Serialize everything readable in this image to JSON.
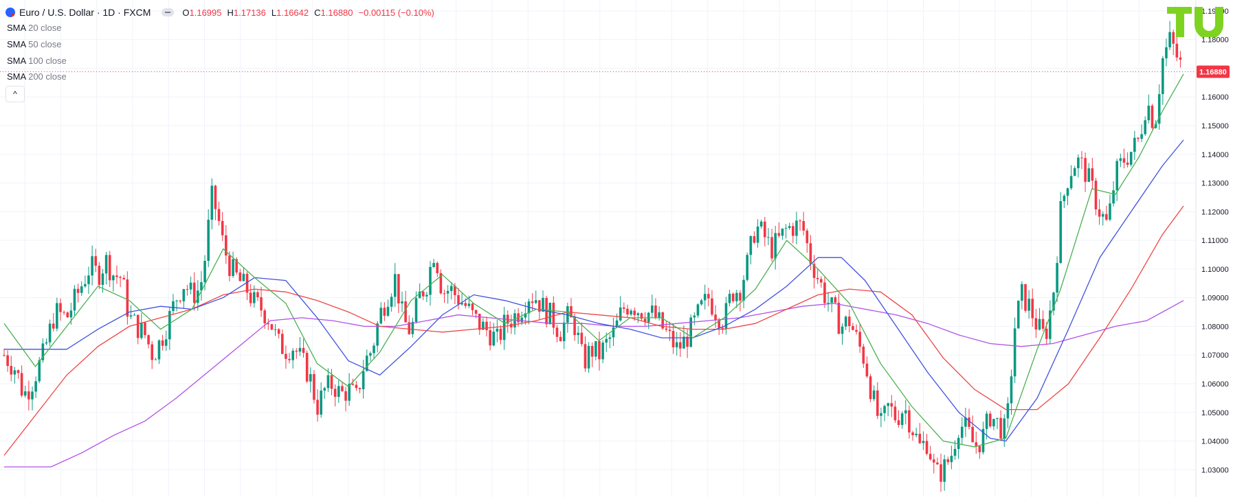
{
  "header": {
    "symbol_title": "Euro / U.S. Dollar · 1D · FXCM",
    "open_key": "O",
    "open_val": "1.16995",
    "high_key": "H",
    "high_val": "1.17136",
    "low_key": "L",
    "low_val": "1.16642",
    "close_key": "C",
    "close_val": "1.16880",
    "change": "−0.00115 (−0.10%)"
  },
  "indicators": [
    {
      "name": "SMA",
      "param": "20 close",
      "color": "#4caf50"
    },
    {
      "name": "SMA",
      "param": "50 close",
      "color": "#3f51e0"
    },
    {
      "name": "SMA",
      "param": "100 close",
      "color": "#ef4444"
    },
    {
      "name": "SMA",
      "param": "200 close",
      "color": "#b04fe8"
    }
  ],
  "collapse_label": "^",
  "colors": {
    "up": "#089981",
    "down": "#f23645",
    "grid": "#f0f3fa",
    "axis_text": "#131722",
    "price_tag": "#f23645"
  },
  "chart_data": {
    "type": "candlestick",
    "instrument": "EURUSD",
    "timeframe": "1D",
    "ylim": [
      1.0205,
      1.1938
    ],
    "y_ticks": [
      "1.19000",
      "1.18000",
      "1.17000",
      "1.16000",
      "1.15000",
      "1.14000",
      "1.13000",
      "1.12000",
      "1.11000",
      "1.10000",
      "1.09000",
      "1.08000",
      "1.07000",
      "1.06000",
      "1.05000",
      "1.04000",
      "1.03000"
    ],
    "last_price": "1.16880",
    "price_path": [
      [
        0,
        1.07
      ],
      [
        15,
        1.065
      ],
      [
        25,
        1.056
      ],
      [
        35,
        1.06
      ],
      [
        50,
        1.07
      ],
      [
        65,
        1.085
      ],
      [
        80,
        1.083
      ],
      [
        95,
        1.092
      ],
      [
        110,
        1.101
      ],
      [
        120,
        1.098
      ],
      [
        130,
        1.103
      ],
      [
        140,
        1.098
      ],
      [
        150,
        1.097
      ],
      [
        160,
        1.083
      ],
      [
        170,
        1.08
      ],
      [
        180,
        1.077
      ],
      [
        190,
        1.07
      ],
      [
        200,
        1.075
      ],
      [
        210,
        1.082
      ],
      [
        220,
        1.09
      ],
      [
        230,
        1.095
      ],
      [
        240,
        1.091
      ],
      [
        250,
        1.093
      ],
      [
        255,
        1.1
      ],
      [
        260,
        1.112
      ],
      [
        265,
        1.125
      ],
      [
        272,
        1.12
      ],
      [
        280,
        1.108
      ],
      [
        290,
        1.1
      ],
      [
        300,
        1.096
      ],
      [
        310,
        1.093
      ],
      [
        320,
        1.088
      ],
      [
        330,
        1.086
      ],
      [
        340,
        1.082
      ],
      [
        350,
        1.074
      ],
      [
        360,
        1.072
      ],
      [
        370,
        1.073
      ],
      [
        380,
        1.068
      ],
      [
        390,
        1.063
      ],
      [
        400,
        1.052
      ],
      [
        410,
        1.058
      ],
      [
        420,
        1.06
      ],
      [
        430,
        1.056
      ],
      [
        440,
        1.058
      ],
      [
        450,
        1.055
      ],
      [
        460,
        1.067
      ],
      [
        470,
        1.072
      ],
      [
        480,
        1.084
      ],
      [
        490,
        1.091
      ],
      [
        500,
        1.097
      ],
      [
        510,
        1.082
      ],
      [
        520,
        1.078
      ],
      [
        530,
        1.09
      ],
      [
        540,
        1.095
      ],
      [
        550,
        1.107
      ],
      [
        560,
        1.092
      ],
      [
        570,
        1.093
      ],
      [
        580,
        1.09
      ],
      [
        590,
        1.087
      ],
      [
        600,
        1.083
      ],
      [
        610,
        1.08
      ],
      [
        620,
        1.078
      ],
      [
        630,
        1.075
      ],
      [
        640,
        1.081
      ],
      [
        650,
        1.083
      ],
      [
        660,
        1.086
      ],
      [
        670,
        1.091
      ],
      [
        680,
        1.09
      ],
      [
        690,
        1.086
      ],
      [
        700,
        1.083
      ],
      [
        710,
        1.078
      ],
      [
        720,
        1.083
      ],
      [
        730,
        1.08
      ],
      [
        740,
        1.067
      ],
      [
        750,
        1.072
      ],
      [
        760,
        1.07
      ],
      [
        770,
        1.074
      ],
      [
        780,
        1.078
      ],
      [
        790,
        1.086
      ],
      [
        800,
        1.088
      ],
      [
        810,
        1.086
      ],
      [
        820,
        1.085
      ],
      [
        830,
        1.084
      ],
      [
        840,
        1.08
      ],
      [
        850,
        1.076
      ],
      [
        860,
        1.072
      ],
      [
        870,
        1.075
      ],
      [
        880,
        1.08
      ],
      [
        890,
        1.086
      ],
      [
        900,
        1.09
      ],
      [
        910,
        1.085
      ],
      [
        920,
        1.082
      ],
      [
        930,
        1.092
      ],
      [
        940,
        1.093
      ],
      [
        950,
        1.102
      ],
      [
        960,
        1.115
      ],
      [
        970,
        1.112
      ],
      [
        980,
        1.107
      ],
      [
        990,
        1.11
      ],
      [
        1000,
        1.114
      ],
      [
        1010,
        1.115
      ],
      [
        1020,
        1.115
      ],
      [
        1030,
        1.104
      ],
      [
        1040,
        1.097
      ],
      [
        1050,
        1.09
      ],
      [
        1060,
        1.085
      ],
      [
        1070,
        1.08
      ],
      [
        1080,
        1.082
      ],
      [
        1090,
        1.075
      ],
      [
        1100,
        1.068
      ],
      [
        1110,
        1.055
      ],
      [
        1120,
        1.045
      ],
      [
        1130,
        1.052
      ],
      [
        1140,
        1.048
      ],
      [
        1150,
        1.052
      ],
      [
        1160,
        1.045
      ],
      [
        1170,
        1.038
      ],
      [
        1180,
        1.04
      ],
      [
        1190,
        1.028
      ],
      [
        1200,
        1.03
      ],
      [
        1210,
        1.035
      ],
      [
        1220,
        1.046
      ],
      [
        1230,
        1.044
      ],
      [
        1240,
        1.038
      ],
      [
        1250,
        1.041
      ],
      [
        1260,
        1.049
      ],
      [
        1270,
        1.046
      ],
      [
        1280,
        1.043
      ],
      [
        1285,
        1.056
      ],
      [
        1290,
        1.078
      ],
      [
        1300,
        1.091
      ],
      [
        1310,
        1.087
      ],
      [
        1320,
        1.08
      ],
      [
        1330,
        1.076
      ],
      [
        1340,
        1.09
      ],
      [
        1350,
        1.12
      ],
      [
        1360,
        1.133
      ],
      [
        1370,
        1.138
      ],
      [
        1380,
        1.135
      ],
      [
        1390,
        1.128
      ],
      [
        1400,
        1.12
      ],
      [
        1410,
        1.115
      ],
      [
        1420,
        1.133
      ],
      [
        1430,
        1.138
      ],
      [
        1440,
        1.141
      ],
      [
        1450,
        1.145
      ],
      [
        1460,
        1.159
      ],
      [
        1470,
        1.15
      ],
      [
        1480,
        1.173
      ],
      [
        1490,
        1.18
      ],
      [
        1500,
        1.173
      ],
      [
        1507,
        1.1688
      ]
    ],
    "sma20": [
      [
        0,
        1.081
      ],
      [
        40,
        1.066
      ],
      [
        80,
        1.08
      ],
      [
        120,
        1.094
      ],
      [
        160,
        1.089
      ],
      [
        200,
        1.079
      ],
      [
        240,
        1.086
      ],
      [
        280,
        1.107
      ],
      [
        320,
        1.097
      ],
      [
        360,
        1.088
      ],
      [
        400,
        1.067
      ],
      [
        440,
        1.059
      ],
      [
        480,
        1.071
      ],
      [
        520,
        1.089
      ],
      [
        560,
        1.098
      ],
      [
        600,
        1.088
      ],
      [
        640,
        1.081
      ],
      [
        680,
        1.086
      ],
      [
        720,
        1.085
      ],
      [
        760,
        1.075
      ],
      [
        800,
        1.083
      ],
      [
        840,
        1.083
      ],
      [
        880,
        1.076
      ],
      [
        920,
        1.083
      ],
      [
        960,
        1.093
      ],
      [
        1000,
        1.11
      ],
      [
        1040,
        1.1
      ],
      [
        1080,
        1.088
      ],
      [
        1120,
        1.067
      ],
      [
        1160,
        1.052
      ],
      [
        1200,
        1.04
      ],
      [
        1240,
        1.038
      ],
      [
        1280,
        1.041
      ],
      [
        1320,
        1.072
      ],
      [
        1350,
        1.093
      ],
      [
        1390,
        1.128
      ],
      [
        1420,
        1.126
      ],
      [
        1450,
        1.139
      ],
      [
        1480,
        1.155
      ],
      [
        1507,
        1.168
      ]
    ],
    "sma50": [
      [
        0,
        1.072
      ],
      [
        40,
        1.072
      ],
      [
        80,
        1.072
      ],
      [
        120,
        1.079
      ],
      [
        160,
        1.085
      ],
      [
        200,
        1.087
      ],
      [
        240,
        1.086
      ],
      [
        280,
        1.09
      ],
      [
        320,
        1.097
      ],
      [
        360,
        1.096
      ],
      [
        400,
        1.083
      ],
      [
        440,
        1.068
      ],
      [
        480,
        1.063
      ],
      [
        520,
        1.073
      ],
      [
        560,
        1.084
      ],
      [
        600,
        1.091
      ],
      [
        640,
        1.089
      ],
      [
        680,
        1.086
      ],
      [
        720,
        1.084
      ],
      [
        760,
        1.081
      ],
      [
        800,
        1.079
      ],
      [
        840,
        1.076
      ],
      [
        880,
        1.076
      ],
      [
        920,
        1.08
      ],
      [
        960,
        1.086
      ],
      [
        1000,
        1.094
      ],
      [
        1040,
        1.104
      ],
      [
        1070,
        1.104
      ],
      [
        1100,
        1.096
      ],
      [
        1140,
        1.08
      ],
      [
        1180,
        1.064
      ],
      [
        1220,
        1.05
      ],
      [
        1260,
        1.041
      ],
      [
        1280,
        1.04
      ],
      [
        1320,
        1.055
      ],
      [
        1360,
        1.079
      ],
      [
        1400,
        1.104
      ],
      [
        1440,
        1.12
      ],
      [
        1480,
        1.136
      ],
      [
        1507,
        1.145
      ]
    ],
    "sma100": [
      [
        0,
        1.035
      ],
      [
        40,
        1.049
      ],
      [
        80,
        1.063
      ],
      [
        120,
        1.073
      ],
      [
        160,
        1.08
      ],
      [
        200,
        1.083
      ],
      [
        240,
        1.086
      ],
      [
        280,
        1.091
      ],
      [
        320,
        1.093
      ],
      [
        360,
        1.092
      ],
      [
        400,
        1.089
      ],
      [
        440,
        1.085
      ],
      [
        480,
        1.08
      ],
      [
        520,
        1.079
      ],
      [
        560,
        1.078
      ],
      [
        600,
        1.079
      ],
      [
        640,
        1.08
      ],
      [
        680,
        1.082
      ],
      [
        720,
        1.085
      ],
      [
        760,
        1.084
      ],
      [
        800,
        1.083
      ],
      [
        840,
        1.08
      ],
      [
        880,
        1.079
      ],
      [
        920,
        1.079
      ],
      [
        960,
        1.081
      ],
      [
        1000,
        1.086
      ],
      [
        1040,
        1.091
      ],
      [
        1080,
        1.093
      ],
      [
        1120,
        1.092
      ],
      [
        1160,
        1.084
      ],
      [
        1200,
        1.069
      ],
      [
        1240,
        1.058
      ],
      [
        1280,
        1.051
      ],
      [
        1320,
        1.051
      ],
      [
        1360,
        1.06
      ],
      [
        1400,
        1.076
      ],
      [
        1440,
        1.093
      ],
      [
        1480,
        1.112
      ],
      [
        1507,
        1.122
      ]
    ],
    "sma200": [
      [
        0,
        1.031
      ],
      [
        60,
        1.031
      ],
      [
        100,
        1.036
      ],
      [
        140,
        1.042
      ],
      [
        180,
        1.047
      ],
      [
        220,
        1.055
      ],
      [
        260,
        1.064
      ],
      [
        300,
        1.073
      ],
      [
        340,
        1.082
      ],
      [
        380,
        1.083
      ],
      [
        420,
        1.082
      ],
      [
        460,
        1.08
      ],
      [
        500,
        1.08
      ],
      [
        540,
        1.082
      ],
      [
        580,
        1.084
      ],
      [
        620,
        1.083
      ],
      [
        660,
        1.082
      ],
      [
        700,
        1.081
      ],
      [
        740,
        1.081
      ],
      [
        780,
        1.08
      ],
      [
        820,
        1.08
      ],
      [
        860,
        1.081
      ],
      [
        900,
        1.082
      ],
      [
        940,
        1.083
      ],
      [
        980,
        1.085
      ],
      [
        1020,
        1.087
      ],
      [
        1060,
        1.088
      ],
      [
        1100,
        1.086
      ],
      [
        1140,
        1.084
      ],
      [
        1180,
        1.081
      ],
      [
        1220,
        1.077
      ],
      [
        1260,
        1.074
      ],
      [
        1300,
        1.073
      ],
      [
        1340,
        1.074
      ],
      [
        1380,
        1.077
      ],
      [
        1420,
        1.08
      ],
      [
        1460,
        1.082
      ],
      [
        1507,
        1.089
      ]
    ]
  }
}
